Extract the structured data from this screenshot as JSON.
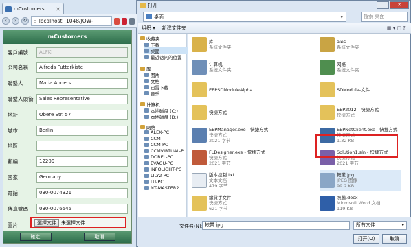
{
  "browser": {
    "tab_title": "mCustomers",
    "url_host": "localhost",
    "url_rest": ":1048/JQW-",
    "app": {
      "title": "mCustomers",
      "fields": [
        {
          "label": "客戶編號",
          "value": "ALFKI",
          "disabled": true
        },
        {
          "label": "公司名稱",
          "value": "Alfreds Futterkiste"
        },
        {
          "label": "聯繫人",
          "value": "Maria Anders"
        },
        {
          "label": "聯繫人頭銜",
          "value": "Sales Representative"
        },
        {
          "label": "地址",
          "value": "Obere Str. 57"
        },
        {
          "label": "城市",
          "value": "Berlin"
        },
        {
          "label": "地區",
          "value": ""
        },
        {
          "label": "郵編",
          "value": "12209"
        },
        {
          "label": "國家",
          "value": "Germany"
        },
        {
          "label": "電話",
          "value": "030-0074321"
        },
        {
          "label": "傳真號碼",
          "value": "030-0076545"
        }
      ],
      "picture_label": "圖片",
      "file_button": "選擇文件",
      "file_status": "未選擇文件",
      "ok": "確定",
      "cancel": "取消"
    }
  },
  "dialog": {
    "title": "打开",
    "breadcrumb": "桌面",
    "search_placeholder": "搜索 桌面",
    "commands": [
      "组织 ▾",
      "新建文件夹"
    ],
    "nav": [
      {
        "label": "收藏夹",
        "icon": "star-icon",
        "group": true
      },
      {
        "label": "下载",
        "icon": "download-icon"
      },
      {
        "label": "桌面",
        "icon": "desktop-icon",
        "selected": true
      },
      {
        "label": "最近访问的位置",
        "icon": "recent-icon"
      },
      {
        "label": "库",
        "icon": "library-icon",
        "group": true
      },
      {
        "label": "图片",
        "icon": "pictures-icon"
      },
      {
        "label": "文档",
        "icon": "documents-icon"
      },
      {
        "label": "迅雷下载",
        "icon": "folder-icon"
      },
      {
        "label": "音乐",
        "icon": "music-icon"
      },
      {
        "label": "计算机",
        "icon": "computer-icon",
        "group": true
      },
      {
        "label": "本地磁盘 (C:)",
        "icon": "drive-icon"
      },
      {
        "label": "本地磁盘 (D:)",
        "icon": "drive-icon"
      },
      {
        "label": "网络",
        "icon": "network-icon",
        "group": true
      },
      {
        "label": "ALEX-PC",
        "icon": "pc-icon"
      },
      {
        "label": "CCM",
        "icon": "pc-icon"
      },
      {
        "label": "CCM-PC",
        "icon": "pc-icon"
      },
      {
        "label": "CCMVIRTUAL-P",
        "icon": "pc-icon"
      },
      {
        "label": "DOREL-PC",
        "icon": "pc-icon"
      },
      {
        "label": "EVAGU-PC",
        "icon": "pc-icon"
      },
      {
        "label": "INFOLIGHT-PC",
        "icon": "pc-icon"
      },
      {
        "label": "LILY2-PC",
        "icon": "pc-icon"
      },
      {
        "label": "LU-PC",
        "icon": "pc-icon"
      },
      {
        "label": "NT-MASTER2",
        "icon": "pc-icon"
      }
    ],
    "files": [
      {
        "name": "库",
        "sub": "系统文件夹",
        "icon": "library-icon",
        "color": "#d9b24a"
      },
      {
        "name": "ales",
        "sub": "系统文件夹",
        "icon": "user-folder-icon",
        "color": "#c9a444"
      },
      {
        "name": "计算机",
        "sub": "系统文件夹",
        "icon": "computer-icon",
        "color": "#6f8fb8"
      },
      {
        "name": "网络",
        "sub": "系统文件夹",
        "icon": "network-icon",
        "color": "#4f8e4f"
      },
      {
        "name": "EEPSDModuleAlpha",
        "sub": "",
        "icon": "folder-icon",
        "color": "#e4c25a"
      },
      {
        "name": "SDModule-文件",
        "sub": "",
        "icon": "folder-icon",
        "color": "#e4c25a"
      },
      {
        "name": "快捷方式",
        "sub": "",
        "icon": "shortcut-folder-icon",
        "color": "#e4c25a"
      },
      {
        "name": "EEP2012 - 快捷方式",
        "sub": "快捷方式",
        "icon": "shortcut-folder-icon",
        "color": "#e4c25a"
      },
      {
        "name": "EEPManager.exe - 快捷方式",
        "sub": "快捷方式",
        "icon": "app-shortcut-icon",
        "color": "#5b7fb0"
      },
      {
        "name": "EEPNetClient.exe - 快捷方式",
        "sub": "快捷方式",
        "icon": "app-shortcut-icon",
        "color": "#3c6aa3"
      },
      {
        "name": "FLDesigner.exe - 快捷方式",
        "sub": "快捷方式",
        "icon": "app-shortcut-icon",
        "color": "#c05a3a"
      },
      {
        "name": "Solution1.sln - 快捷方式",
        "sub": "快捷方式",
        "icon": "solution-icon",
        "color": "#7a5fa8"
      },
      {
        "name": "版本控制.txt",
        "sub": "文本文档",
        "icon": "text-file-icon",
        "color": "#e8edf3"
      },
      {
        "name": "較業.jpg",
        "sub": "JPEG 图像",
        "icon": "image-file-icon",
        "color": "#8aa6c6",
        "selected": true
      },
      {
        "name": "繳貨手文件",
        "sub": "快捷方式",
        "icon": "shortcut-folder-icon",
        "color": "#e4c25a"
      },
      {
        "name": "照騰.docx",
        "sub": "Microsoft Word 文档",
        "icon": "word-file-icon",
        "color": "#2f5fa8"
      }
    ],
    "file_details": {
      "FLDesigner.exe - 快捷方式": "2021 字节",
      "EEPManager.exe - 快捷方式": "2021 字节",
      "EEPNetClient.exe - 快捷方式": "1.32 KB",
      "Solution1.sln - 快捷方式": "2021 字节",
      "版本控制.txt": "479 字节",
      "較業.jpg": "99.2 KB",
      "繳貨手文件": "621 字节",
      "照騰.docx": "119 KB"
    },
    "filename_label": "文件名(N):",
    "filename_value": "較業.jpg",
    "filetype_value": "所有文件",
    "open": "打开(O)",
    "cancel": "取消"
  },
  "colors": {
    "selection": "#dd2222",
    "app_header": "#2e6e4c"
  }
}
